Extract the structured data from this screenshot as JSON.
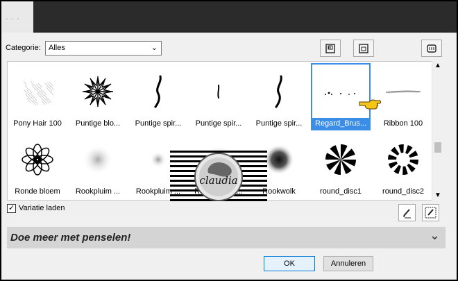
{
  "titlebar": {
    "tab_text": "- - -"
  },
  "category": {
    "label": "Categorie:",
    "value": "Alles"
  },
  "brushes": [
    {
      "label": "Pony Hair 100",
      "icon": "pony-hair"
    },
    {
      "label": "Puntige blo...",
      "icon": "spiky-flower"
    },
    {
      "label": "Puntige spir...",
      "icon": "spiral-tall"
    },
    {
      "label": "Puntige spir...",
      "icon": "spiral-small"
    },
    {
      "label": "Puntige spir...",
      "icon": "spiral-tall"
    },
    {
      "label": "Regard_Brus...",
      "icon": "regard",
      "selected": true
    },
    {
      "label": "Ribbon 100",
      "icon": "ribbon"
    },
    {
      "label": "Ronde bloem",
      "icon": "round-flower"
    },
    {
      "label": "Rookpluim ...",
      "icon": "smoke"
    },
    {
      "label": "Rookpluim ...",
      "icon": "smoke-small"
    },
    {
      "label": "Rookpluim s...",
      "icon": "smoke"
    },
    {
      "label": "Rookwolk",
      "icon": "smoke-dark"
    },
    {
      "label": "round_disc1",
      "icon": "disc1"
    },
    {
      "label": "round_disc2",
      "icon": "disc2"
    }
  ],
  "variatie": {
    "label": "Variatie laden",
    "checked": true
  },
  "more": {
    "label": "Doe meer met penselen!"
  },
  "buttons": {
    "ok": "OK",
    "cancel": "Annuleren"
  },
  "watermark": {
    "name": "claudia"
  },
  "colors": {
    "accent": "#3b8ee8",
    "pointer": "#f5c518"
  }
}
